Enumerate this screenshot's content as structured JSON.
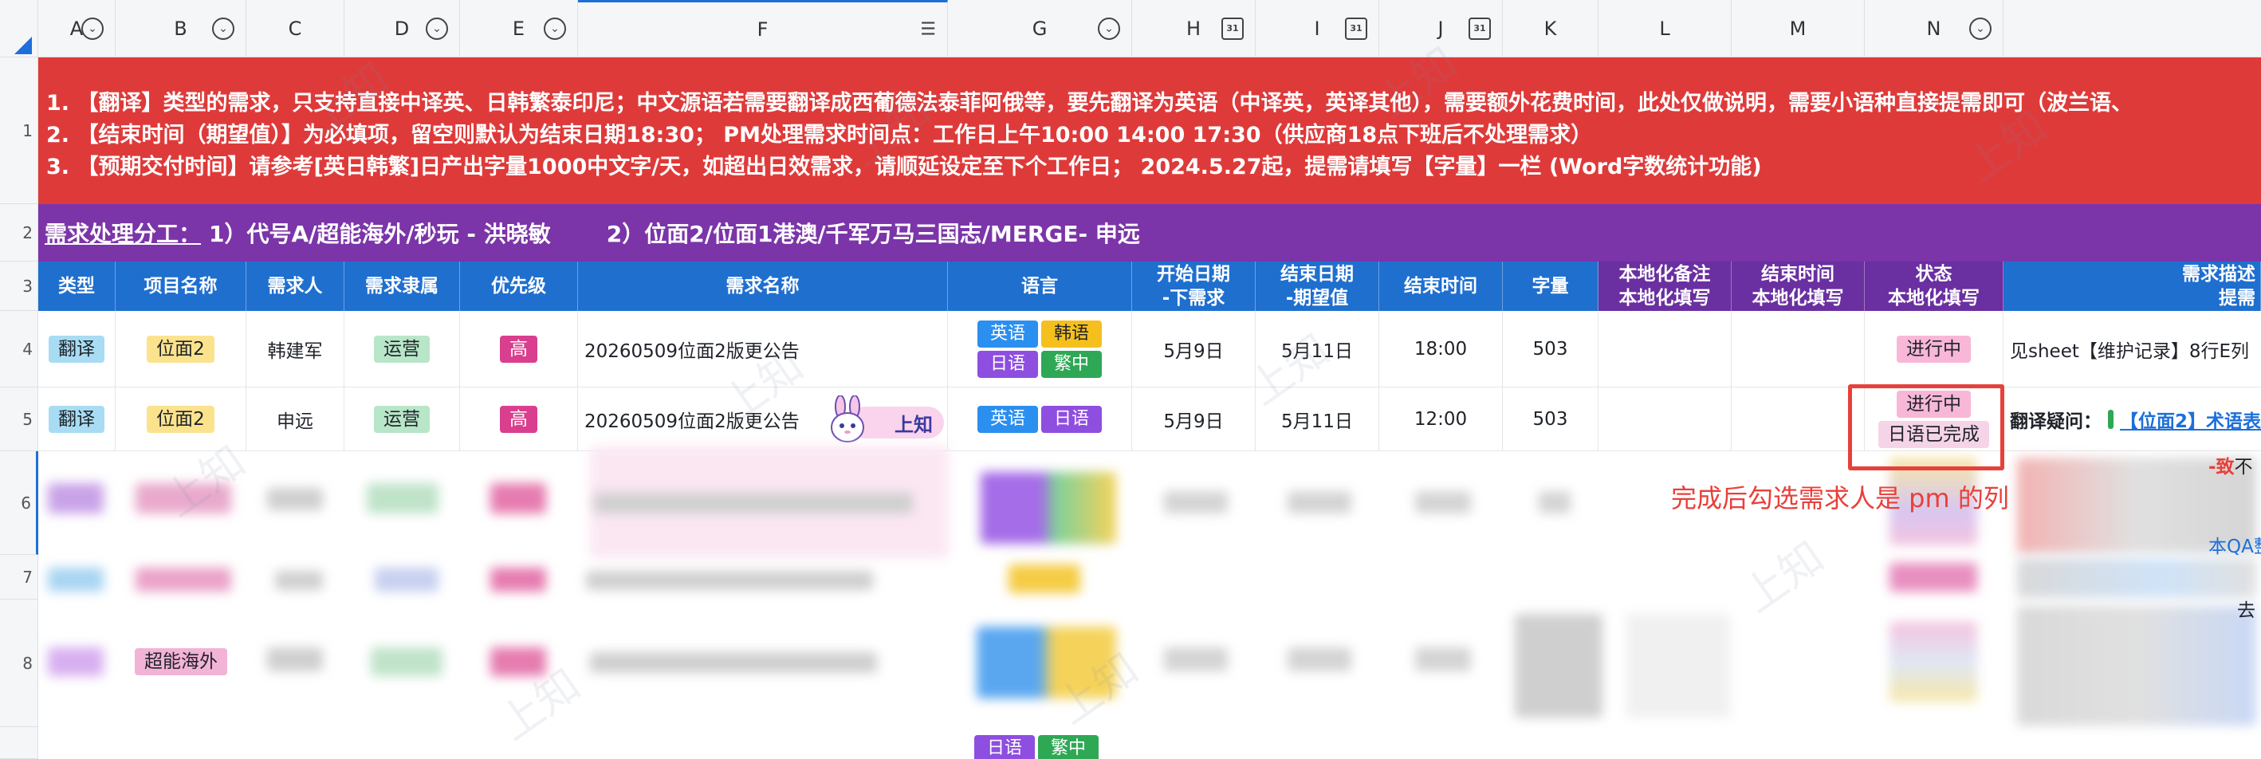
{
  "columns": [
    {
      "letter": "A",
      "icon": "dropdown-icon"
    },
    {
      "letter": "B",
      "icon": "dropdown-icon"
    },
    {
      "letter": "C",
      "icon": ""
    },
    {
      "letter": "D",
      "icon": "dropdown-icon"
    },
    {
      "letter": "E",
      "icon": "dropdown-icon"
    },
    {
      "letter": "F",
      "icon": "filter-icon"
    },
    {
      "letter": "G",
      "icon": "dropdown-icon"
    },
    {
      "letter": "H",
      "icon": "calendar-icon"
    },
    {
      "letter": "I",
      "icon": "calendar-icon"
    },
    {
      "letter": "J",
      "icon": "calendar-icon"
    },
    {
      "letter": "K",
      "icon": ""
    },
    {
      "letter": "L",
      "icon": ""
    },
    {
      "letter": "M",
      "icon": ""
    },
    {
      "letter": "N",
      "icon": "dropdown-icon"
    }
  ],
  "calendar_glyph": "31",
  "row_numbers": [
    "1",
    "2",
    "3",
    "4",
    "5",
    "6",
    "7",
    "8"
  ],
  "banner_red": {
    "line1": "1. 【翻译】类型的需求，只支持直接中译英、日韩繁泰印尼；中文源语若需要翻译成西葡德法泰菲阿俄等，要先翻译为英语（中译英，英译其他），需要额外花费时间，此处仅做说明，需要小语种直接提需即可（波兰语、",
    "line2": "2. 【结束时间（期望值）】为必填项，留空则默认为结束日期18:30；    PM处理需求时间点：工作日上午10:00      14:00      17:30（供应商18点下班后不处理需求）",
    "line3": "3. 【预期交付时间】请参考[英日韩繁]日产出字量1000中文字/天，如超出日效需求，请顺延设定至下个工作日；  2024.5.27起，提需请填写【字量】一栏 (Word字数统计功能)"
  },
  "banner_purple": {
    "label": "需求处理分工：",
    "part1": "1）代号A/超能海外/秒玩 - 洪晓敏",
    "part2": "2）位面2/位面1港澳/千军万马三国志/MERGE- 申远"
  },
  "headers": [
    {
      "l1": "类型",
      "l2": ""
    },
    {
      "l1": "项目名称",
      "l2": ""
    },
    {
      "l1": "需求人",
      "l2": ""
    },
    {
      "l1": "需求隶属",
      "l2": ""
    },
    {
      "l1": "优先级",
      "l2": ""
    },
    {
      "l1": "需求名称",
      "l2": ""
    },
    {
      "l1": "语言",
      "l2": ""
    },
    {
      "l1": "开始日期",
      "l2": "-下需求"
    },
    {
      "l1": "结束日期",
      "l2": "-期望值"
    },
    {
      "l1": "结束时间",
      "l2": ""
    },
    {
      "l1": "字量",
      "l2": ""
    },
    {
      "l1": "本地化备注",
      "l2": "本地化填写"
    },
    {
      "l1": "结束时间",
      "l2": "本地化填写"
    },
    {
      "l1": "状态",
      "l2": "本地化填写"
    },
    {
      "l1": "需求描述",
      "l2": "提需"
    }
  ],
  "rows": [
    {
      "type": "翻译",
      "project": "位面2",
      "requester": "韩建军",
      "dept": "运营",
      "priority": "高",
      "name": "20260509位面2版更公告",
      "langs": [
        "英语",
        "韩语",
        "日语",
        "繁中"
      ],
      "start": "5月9日",
      "end": "5月11日",
      "time": "18:00",
      "words": "503",
      "status1": "进行中",
      "status2": "",
      "desc": "见sheet【维护记录】8行E列",
      "desc_prefix": "",
      "desc_link": ""
    },
    {
      "type": "翻译",
      "project": "位面2",
      "requester": "申远",
      "dept": "运营",
      "priority": "高",
      "name": "20260509位面2版更公告",
      "langs": [
        "英语",
        "日语"
      ],
      "start": "5月9日",
      "end": "5月11日",
      "time": "12:00",
      "words": "503",
      "status1": "进行中",
      "status2": "日语已完成",
      "desc": "",
      "desc_prefix": "翻译疑问：",
      "desc_link": "【位面2】术语表"
    }
  ],
  "partial_rows": {
    "row8_project": "超能海外",
    "last_row_langs": [
      "日语",
      "繁中"
    ],
    "row6_desc_red": "-致",
    "row6_desc_black": "不",
    "row7_link": "本QA整",
    "row8_desc_tail": "去"
  },
  "sticker_label": "上知",
  "annotation": "完成后勾选需求人是 pm 的列",
  "watermark_text": "上知",
  "colors": {
    "red_banner": "#df3a3a",
    "purple_banner": "#7b35a8",
    "header_blue": "#1f6fcf",
    "header_purple": "#6a2fa0",
    "annotation_red": "#e8403a"
  }
}
